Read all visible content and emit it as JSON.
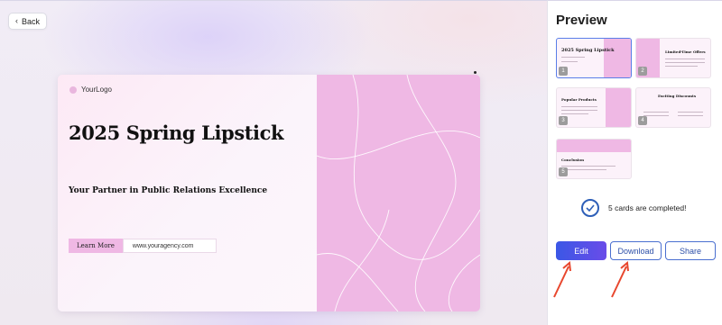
{
  "toolbar": {
    "back_label": "Back"
  },
  "slide": {
    "logo_text": "YourLogo",
    "title": "2025 Spring Lipstick",
    "subtitle": "Your Partner in Public Relations Excellence",
    "cta_label": "Learn More",
    "url": "www.youragency.com"
  },
  "preview": {
    "title": "Preview",
    "thumbnails": [
      {
        "number": "1",
        "title": "2025 Spring Lipstick",
        "active": true
      },
      {
        "number": "2",
        "title": "Limited-Time Offers",
        "active": false
      },
      {
        "number": "3",
        "title": "Popular Products",
        "active": false
      },
      {
        "number": "4",
        "title": "Exciting Discounts",
        "active": false
      },
      {
        "number": "5",
        "title": "Conclusion",
        "active": false
      }
    ],
    "status_text": "5 cards are completed!"
  },
  "actions": {
    "edit_label": "Edit",
    "download_label": "Download",
    "share_label": "Share"
  },
  "colors": {
    "accent": "#3b57e6",
    "pink": "#efb8e4",
    "annotation_arrow": "#e8472e"
  }
}
